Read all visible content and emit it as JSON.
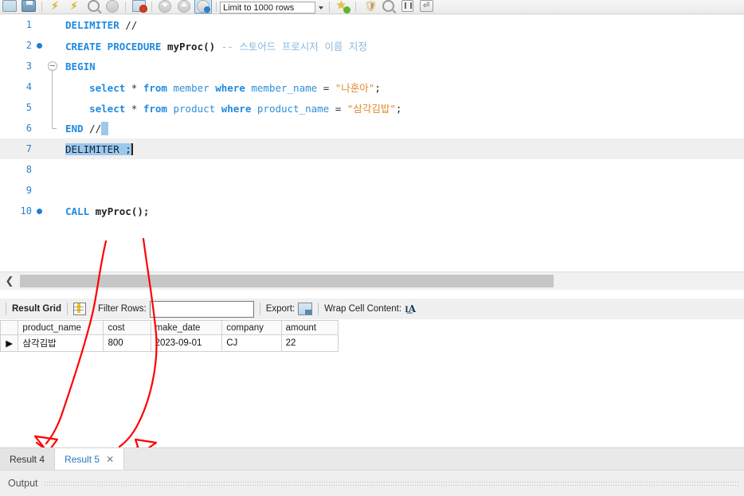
{
  "toolbar": {
    "limit_value": "Limit to 1000 rows",
    "icons": [
      "new-file-icon",
      "save-file-icon",
      "execute-script-icon",
      "execute-current-statement-icon",
      "explain-query-icon",
      "stop-execution-icon",
      "stop-on-error-icon",
      "toggle-down-icon",
      "toggle-up-icon",
      "commit-icon",
      "beautify-icon",
      "find-icon",
      "pause-icon",
      "wrap-icon"
    ]
  },
  "editor": {
    "lines": [
      {
        "num": "1",
        "marker": "",
        "fold": "",
        "text": "DELIMITER //"
      },
      {
        "num": "2",
        "marker": "dot",
        "fold": "",
        "text": "CREATE PROCEDURE myProc() -- 스토어드 프로시저 이름 지정"
      },
      {
        "num": "3",
        "marker": "",
        "fold": "start",
        "text": "BEGIN"
      },
      {
        "num": "4",
        "marker": "",
        "fold": "mid",
        "text": "    select * from member where member_name = \"나훈아\";"
      },
      {
        "num": "5",
        "marker": "",
        "fold": "mid",
        "text": "    select * from product where product_name = \"삼각김밥\";"
      },
      {
        "num": "6",
        "marker": "",
        "fold": "end",
        "text": "END //"
      },
      {
        "num": "7",
        "marker": "",
        "fold": "",
        "text": "DELIMITER ;"
      },
      {
        "num": "8",
        "marker": "",
        "fold": "",
        "text": ""
      },
      {
        "num": "9",
        "marker": "",
        "fold": "",
        "text": ""
      },
      {
        "num": "10",
        "marker": "dot",
        "fold": "",
        "text": "CALL myProc();"
      }
    ],
    "l1_kw": "DELIMITER",
    "l1_delim": "//",
    "l2_kw": "CREATE PROCEDURE",
    "l2_name": "myProc()",
    "l2_comment": "-- 스토어드 프로시저 이름 지정",
    "l3_kw": "BEGIN",
    "l4_select": "select",
    "l4_star": "*",
    "l4_from": "from",
    "l4_table": "member",
    "l4_where": "where",
    "l4_col": "member_name",
    "l4_eq": "=",
    "l4_value": "\"나훈아\"",
    "l4_semi": ";",
    "l5_select": "select",
    "l5_star": "*",
    "l5_from": "from",
    "l5_table": "product",
    "l5_where": "where",
    "l5_col": "product_name",
    "l5_eq": "=",
    "l5_value": "\"삼각김밥\"",
    "l5_semi": ";",
    "l6_kw": "END",
    "l6_delim": "//",
    "l7_selected": "DELIMITER ;",
    "l10_call": "CALL",
    "l10_name": "myProc();",
    "selected_line": 7,
    "current_line": 7
  },
  "result_toolbar": {
    "result_grid_label": "Result Grid",
    "grid_icon": "grid-icon",
    "filter_label": "Filter Rows:",
    "filter_value": "",
    "filter_placeholder": "",
    "export_label": "Export:",
    "export_icon": "export-icon",
    "wrap_label": "Wrap Cell Content:",
    "wrap_icon": "wrap-text-icon"
  },
  "grid": {
    "columns": [
      "product_name",
      "cost",
      "make_date",
      "company",
      "amount"
    ],
    "rows": [
      {
        "selector": "▶",
        "cells": [
          "삼각김밥",
          "800",
          "2023-09-01",
          "CJ",
          "22"
        ]
      }
    ]
  },
  "result_tabs": [
    {
      "label": "Result 4",
      "active": false,
      "closable": false
    },
    {
      "label": "Result 5",
      "active": true,
      "closable": true,
      "close": "✕"
    }
  ],
  "output": {
    "label": "Output"
  },
  "annotations": {
    "color": "#ff0000",
    "arrows": [
      {
        "name": "arrow-to-result-4",
        "target": "Result 4 tab"
      },
      {
        "name": "arrow-to-result-5",
        "target": "Result 5 tab"
      }
    ]
  },
  "colors": {
    "keyword": "#1f8ae0",
    "comment": "#8fb8d8",
    "string": "#e08a2e",
    "line_number": "#2f7fc9",
    "selection": "#9cc8ec",
    "current_line": "#efefef",
    "annotation_red": "#ff0000",
    "active_tab_text": "#2878c0"
  }
}
